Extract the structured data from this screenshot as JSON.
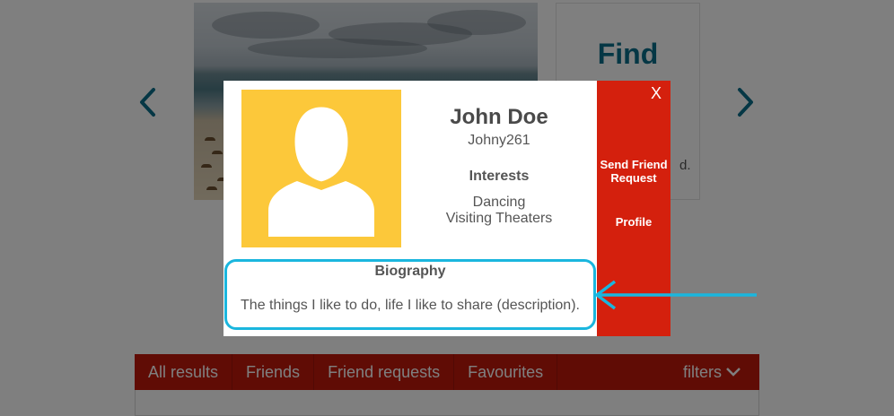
{
  "background": {
    "find_title": "Find",
    "find_partial_text": "d."
  },
  "tabs": [
    {
      "label": "All results"
    },
    {
      "label": "Friends"
    },
    {
      "label": "Friend requests"
    },
    {
      "label": "Favourites"
    }
  ],
  "filters_label": "filters",
  "profile": {
    "name": "John Doe",
    "username": "Johny261",
    "interests_heading": "Interests",
    "interests": [
      "Dancing",
      "Visiting Theaters"
    ]
  },
  "actions": {
    "close": "X",
    "send_friend_request": "Send Friend Request",
    "profile": "Profile"
  },
  "biography": {
    "heading": "Biography",
    "text": "The things I like to do, life I like to share (description)."
  },
  "colors": {
    "accent_red": "#d4200d",
    "tab_red": "#c0180b",
    "avatar_yellow": "#fcc83a",
    "highlight_blue": "#1ab6de",
    "title_teal": "#0b6e8a"
  },
  "icons": {
    "nav_prev": "chevron-left-icon",
    "nav_next": "chevron-right-icon",
    "filters": "chevron-down-icon",
    "avatar": "user-silhouette-icon",
    "pointer": "arrow-left-icon"
  }
}
